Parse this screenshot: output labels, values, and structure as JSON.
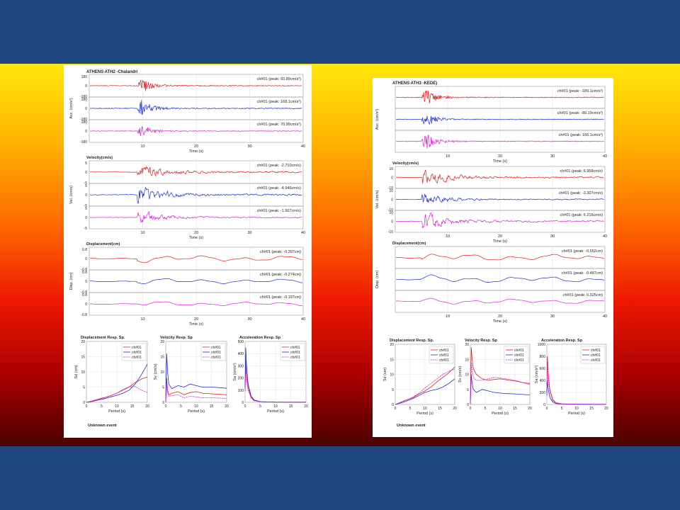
{
  "background": {
    "frame_color": "#1f4680"
  },
  "colors": {
    "ch1": "#e02020",
    "ch2": "#1d2fd0",
    "ch3": "#e020e0"
  },
  "chart_data": [
    {
      "id": "left",
      "station": "ATHENS  ATH2 -Chalandri",
      "footer": "Unknown event",
      "time_label": "Time (s)",
      "time_ticks": [
        "10",
        "20",
        "30",
        "40"
      ],
      "groups": [
        {
          "title": "",
          "ylabel": "Acc. (cm/s²)",
          "yticks": [
            "180",
            "0",
            "-180"
          ],
          "traces": [
            {
              "label": "ch#01 (peak: 93.89cm/s²)",
              "peak": 93.89,
              "unit": "cm/s²",
              "yticks": [
                "180",
                "0",
                "-180"
              ]
            },
            {
              "label": "ch#01 (peak: 168.1cm/s²)",
              "peak": 168.1,
              "unit": "cm/s²",
              "yticks": [
                "180",
                "0",
                "-180"
              ]
            },
            {
              "label": "ch#01 (peak: 70.99cm/s²)",
              "peak": 70.99,
              "unit": "cm/s²",
              "yticks": [
                "180",
                "0",
                "-180"
              ]
            }
          ]
        },
        {
          "title": "Velocity(cm/s)",
          "ylabel": "Vel. (cm/s)",
          "traces": [
            {
              "label": "ch#01 (peak: -2.710cm/s)",
              "peak": -2.71,
              "unit": "cm/s",
              "yticks": [
                "5",
                "0",
                "-5"
              ]
            },
            {
              "label": "ch#01 (peak: -4.946cm/s)",
              "peak": -4.946,
              "unit": "cm/s",
              "yticks": [
                "5",
                "0",
                "-5"
              ]
            },
            {
              "label": "ch#01 (peak: -1.507cm/s)",
              "peak": -1.507,
              "unit": "cm/s",
              "yticks": [
                "5",
                "0",
                "-5"
              ]
            }
          ]
        },
        {
          "title": "Displacement(cm)",
          "ylabel": "Disp. (cm)",
          "traces": [
            {
              "label": "ch#01 (peak: -0.397cm)",
              "peak": -0.397,
              "unit": "cm",
              "yticks": [
                "0.8",
                "0",
                "-0.8"
              ]
            },
            {
              "label": "ch#01 (peak: -0.274cm)",
              "peak": -0.274,
              "unit": "cm",
              "yticks": [
                "0.8",
                "0",
                "-0.8"
              ]
            },
            {
              "label": "ch#01 (peak: -0.197cm)",
              "peak": -0.197,
              "unit": "cm",
              "yticks": [
                "0.8",
                "0",
                "-0.8"
              ]
            }
          ]
        }
      ],
      "spectra": [
        {
          "title": "Displacement Resp. Sp.",
          "ylabel": "Sd (cm)",
          "xlabel": "Period (s)",
          "xticks": [
            "0",
            "5",
            "10",
            "15",
            "20"
          ],
          "yticks": [
            "20",
            "15",
            "10",
            "5",
            "0"
          ],
          "ylim": [
            0,
            20
          ],
          "legend": [
            "ch#01",
            "ch#01",
            "ch#01"
          ],
          "series": [
            {
              "x": [
                0,
                2,
                4,
                6,
                8,
                10,
                12,
                14,
                16,
                18,
                20
              ],
              "values": [
                0,
                0.5,
                1.1,
                1.6,
                2.2,
                3.0,
                4.0,
                5.0,
                6.5,
                7.6,
                8.3
              ]
            },
            {
              "x": [
                0,
                2,
                4,
                6,
                8,
                10,
                12,
                14,
                16,
                18,
                20
              ],
              "values": [
                0,
                0.3,
                0.8,
                1.2,
                1.8,
                2.3,
                3.0,
                4.0,
                6.0,
                9.0,
                12.5
              ]
            },
            {
              "x": [
                0,
                2,
                4,
                6,
                8,
                10,
                12,
                14,
                16,
                18,
                20
              ],
              "values": [
                0,
                0.4,
                0.9,
                1.5,
                2.2,
                3.0,
                4.2,
                5.1,
                5.2,
                4.0,
                3.2
              ]
            }
          ]
        },
        {
          "title": "Velocity Resp. Sp",
          "ylabel": "Sv (cm/s)",
          "xlabel": "Period (s)",
          "xticks": [
            "0",
            "5",
            "10",
            "15",
            "20"
          ],
          "yticks": [
            "20",
            "15",
            "10",
            "5",
            "0"
          ],
          "ylim": [
            0,
            20
          ],
          "legend": [
            "ch#01",
            "ch#01",
            "ch#01"
          ],
          "series": [
            {
              "x": [
                0,
                0.3,
                0.6,
                1,
                2,
                4,
                6,
                8,
                10,
                12,
                15,
                18,
                20
              ],
              "values": [
                0,
                8,
                4,
                2.5,
                3,
                3.5,
                2.5,
                3.2,
                3.5,
                3,
                2.8,
                2.6,
                2.5
              ]
            },
            {
              "x": [
                0,
                0.3,
                0.6,
                1,
                2,
                4,
                6,
                8,
                10,
                12,
                15,
                18,
                20
              ],
              "values": [
                0,
                16,
                10,
                6,
                4.5,
                5.5,
                5,
                6,
                5.5,
                5,
                5,
                4.8,
                4.6
              ]
            },
            {
              "x": [
                0,
                0.3,
                0.6,
                1,
                2,
                4,
                6,
                8,
                10,
                12,
                15,
                18,
                20
              ],
              "values": [
                0,
                6,
                3,
                2,
                2.2,
                2.5,
                1.5,
                2,
                1.8,
                1.5,
                1.5,
                1.4,
                1.3
              ]
            }
          ]
        },
        {
          "title": "Acceleration Resp. Sp",
          "ylabel": "Sa (cm/s²)",
          "xlabel": "Period (s)",
          "xticks": [
            "0",
            "5",
            "10",
            "15",
            "20"
          ],
          "yticks": [
            "500",
            "400",
            "300",
            "200",
            "100",
            "0"
          ],
          "ylim": [
            0,
            500
          ],
          "legend": [
            "ch#01",
            "ch#01",
            "ch#01"
          ],
          "series": [
            {
              "x": [
                0,
                0.2,
                0.5,
                1,
                2,
                3,
                5,
                10,
                20
              ],
              "values": [
                100,
                350,
                220,
                120,
                40,
                15,
                5,
                2,
                1
              ]
            },
            {
              "x": [
                0,
                0.2,
                0.5,
                1,
                2,
                3,
                5,
                10,
                20
              ],
              "values": [
                120,
                450,
                300,
                150,
                50,
                20,
                6,
                2,
                1
              ]
            },
            {
              "x": [
                0,
                0.2,
                0.5,
                1,
                2,
                3,
                5,
                10,
                20
              ],
              "values": [
                90,
                280,
                180,
                100,
                35,
                12,
                4,
                2,
                1
              ]
            }
          ]
        }
      ]
    },
    {
      "id": "right",
      "station": "ATHENS  ATH3 -KEDE)",
      "footer": "Unknown event",
      "time_label": "Time (s)",
      "time_ticks": [
        "10",
        "20",
        "30",
        "40"
      ],
      "groups": [
        {
          "title": "",
          "ylabel": "Acc. (cm/s²)",
          "traces": [
            {
              "label": "ch#01 (peak: -189.1cm/s²)",
              "peak": -189.1,
              "unit": "cm/s²",
              "yticks": [
                "",
                "",
                ""
              ]
            },
            {
              "label": "ch#01 (peak: -89.19cm/s²)",
              "peak": -89.19,
              "unit": "cm/s²",
              "yticks": [
                "",
                "",
                ""
              ]
            },
            {
              "label": "ch#01 (peak: 166.1cm/s²)",
              "peak": 166.1,
              "unit": "cm/s²",
              "yticks": [
                "",
                "",
                ""
              ]
            }
          ]
        },
        {
          "title": "Velocity(cm/s)",
          "ylabel": "Vel. (cm/s)",
          "traces": [
            {
              "label": "ch#01 (peak: 6.958cm/s)",
              "peak": 6.958,
              "unit": "cm/s",
              "yticks": [
                "10",
                "0",
                "-10"
              ]
            },
            {
              "label": "ch#01 (peak: -3.307cm/s)",
              "peak": -3.307,
              "unit": "cm/s",
              "yticks": [
                "10",
                "0",
                "-10"
              ]
            },
            {
              "label": "ch#01 (peak: 6.216cm/s)",
              "peak": 6.216,
              "unit": "cm/s",
              "yticks": [
                "10",
                "0",
                "-10"
              ]
            }
          ]
        },
        {
          "title": "Displacement(cm)",
          "ylabel": "Disp. (cm)",
          "traces": [
            {
              "label": "ch#01 (peak: -0.552cm)",
              "peak": -0.552,
              "unit": "cm",
              "yticks": [
                "",
                "",
                ""
              ]
            },
            {
              "label": "ch#01 (peak: -0.487cm)",
              "peak": -0.487,
              "unit": "cm",
              "yticks": [
                "",
                "",
                ""
              ]
            },
            {
              "label": "ch#01 (peak: 0.325cm)",
              "peak": 0.325,
              "unit": "cm",
              "yticks": [
                "",
                "",
                ""
              ]
            }
          ]
        }
      ],
      "spectra": [
        {
          "title": "Displacement Resp. Sp.",
          "ylabel": "Sd (cm)",
          "xlabel": "Period (s)",
          "xticks": [
            "0",
            "5",
            "10",
            "15",
            "20"
          ],
          "yticks": [
            "20",
            "15",
            "10",
            "5",
            "0"
          ],
          "ylim": [
            0,
            20
          ],
          "legend": [
            "ch#01",
            "ch#01",
            "ch#01"
          ],
          "series": [
            {
              "x": [
                0,
                2,
                4,
                6,
                8,
                10,
                12,
                14,
                16,
                18,
                20
              ],
              "values": [
                0,
                0.8,
                1.6,
                2.3,
                3.5,
                4.5,
                5.8,
                7.5,
                9.0,
                10.5,
                12.5
              ]
            },
            {
              "x": [
                0,
                2,
                4,
                6,
                8,
                10,
                12,
                14,
                16,
                18,
                20
              ],
              "values": [
                0,
                0.5,
                1.2,
                2.0,
                3.0,
                4.0,
                4.6,
                5.0,
                5.8,
                7.0,
                8.5
              ]
            },
            {
              "x": [
                0,
                2,
                4,
                6,
                8,
                10,
                12,
                14,
                16,
                18,
                20
              ],
              "values": [
                0,
                0.7,
                1.5,
                2.5,
                3.8,
                5.5,
                7.0,
                8.5,
                10.0,
                11.0,
                11.8
              ]
            }
          ]
        },
        {
          "title": "Velocity Resp. Sp",
          "ylabel": "Sv (cm/s)",
          "xlabel": "Period (s)",
          "xticks": [
            "0",
            "5",
            "10",
            "15",
            "20"
          ],
          "yticks": [
            "20",
            "15",
            "10",
            "5",
            "0"
          ],
          "ylim": [
            0,
            20
          ],
          "legend": [
            "ch#01",
            "ch#01",
            "ch#01"
          ],
          "series": [
            {
              "x": [
                0,
                0.3,
                0.6,
                1,
                2,
                4,
                6,
                8,
                10,
                12,
                15,
                18,
                20
              ],
              "values": [
                0,
                19,
                15,
                12,
                10,
                8.5,
                8,
                8.3,
                8.5,
                8.2,
                7.8,
                7.2,
                7.0
              ]
            },
            {
              "x": [
                0,
                0.3,
                0.6,
                1,
                2,
                4,
                6,
                8,
                10,
                12,
                15,
                18,
                20
              ],
              "values": [
                0,
                10,
                7,
                5,
                4,
                5,
                4.5,
                4,
                3.8,
                3.6,
                3.5,
                3.3,
                3.2
              ]
            },
            {
              "x": [
                0,
                0.3,
                0.6,
                1,
                2,
                4,
                6,
                8,
                10,
                12,
                15,
                18,
                20
              ],
              "values": [
                0,
                14,
                11,
                9,
                8,
                8,
                8.5,
                9,
                8.8,
                8.5,
                8,
                7.2,
                6.6
              ]
            }
          ]
        },
        {
          "title": "Acceleration Resp. Sp",
          "ylabel": "Sa (cm/s²)",
          "xlabel": "Period (s)",
          "xticks": [
            "0",
            "5",
            "10",
            "15",
            "20"
          ],
          "yticks": [
            "1000",
            "800",
            "600",
            "400",
            "200",
            "0"
          ],
          "ylim": [
            0,
            1000
          ],
          "legend": [
            "ch#01",
            "ch#01",
            "ch#01"
          ],
          "series": [
            {
              "x": [
                0,
                0.2,
                0.5,
                1,
                2,
                3,
                5,
                10,
                20
              ],
              "values": [
                200,
                800,
                500,
                250,
                80,
                30,
                10,
                4,
                2
              ]
            },
            {
              "x": [
                0,
                0.2,
                0.5,
                1,
                2,
                3,
                5,
                10,
                20
              ],
              "values": [
                150,
                400,
                250,
                120,
                40,
                15,
                6,
                3,
                1
              ]
            },
            {
              "x": [
                0,
                0.2,
                0.5,
                1,
                2,
                3,
                5,
                10,
                20
              ],
              "values": [
                180,
                650,
                420,
                200,
                60,
                25,
                8,
                3,
                2
              ]
            }
          ]
        }
      ]
    }
  ]
}
